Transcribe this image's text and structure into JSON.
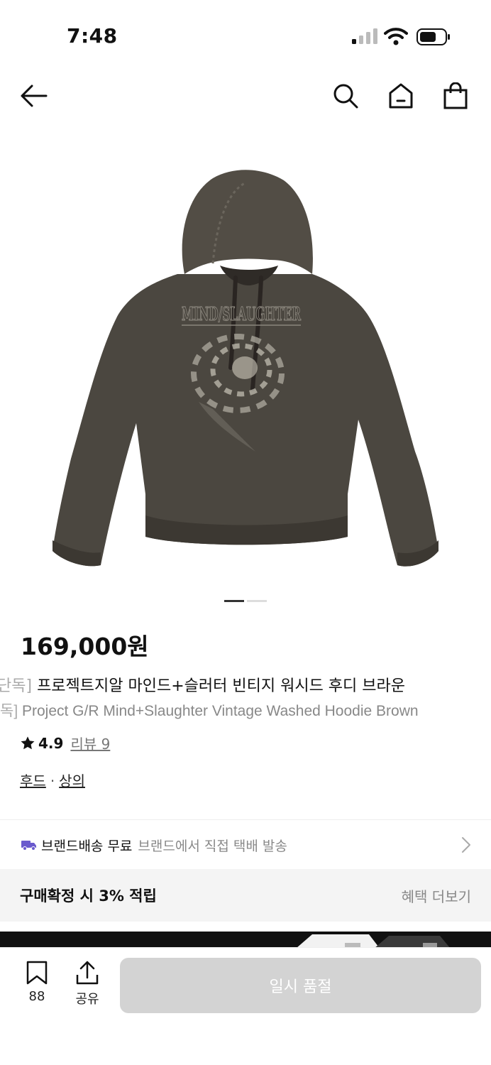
{
  "status": {
    "time": "7:48"
  },
  "product": {
    "price": "169,000원",
    "title_ko_cut": "단독]",
    "title_ko": " 프로젝트지알 마인드+슬러터 빈티지 워시드 후디 브라운",
    "title_en_cut": "독]",
    "title_en": " Project G/R Mind+Slaughter Vintage Washed Hoodie Brown",
    "rating": "4.9",
    "review_label": "리뷰 9",
    "category_1": "후드",
    "category_sep": "·",
    "category_2": "상의",
    "hoodie_print": "MIND/SLAUGHTER"
  },
  "gallery": {
    "total_images": 2,
    "current_index": 1
  },
  "delivery": {
    "label": "브랜드배송 무료",
    "description": "브랜드에서 직접 택배 발송"
  },
  "benefit": {
    "label": "구매확정 시 3% 적립",
    "more": "혜택 더보기"
  },
  "bottom_bar": {
    "like_count": "88",
    "share_label": "공유",
    "cta_label": "일시 품절"
  },
  "colors": {
    "hoodie": "#4b4740",
    "cta_disabled": "#d3d3d3",
    "truck": "#6a5acd"
  },
  "icons": [
    "back-arrow-icon",
    "search-icon",
    "home-icon",
    "shopping-bag-icon",
    "star-icon",
    "truck-icon",
    "chevron-right-icon",
    "bookmark-icon",
    "share-icon"
  ]
}
